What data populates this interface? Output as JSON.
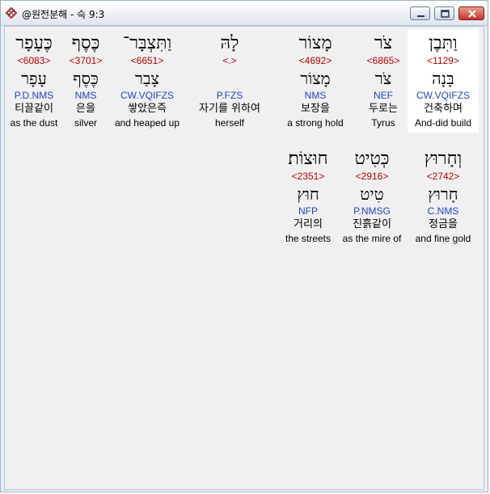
{
  "window": {
    "title": "@원전분해 - 슥 9:3"
  },
  "icons": {
    "app": "app-icon",
    "minimize": "minimize-icon",
    "maximize": "maximize-icon",
    "close": "close-icon"
  },
  "colors": {
    "strong": "#c00000",
    "morph": "#2244cc",
    "selected_bg": "#ffffff"
  },
  "row1": [
    {
      "heb": "וַתִּבֶן",
      "strong": "<1129>",
      "lemma": "בָּנָה",
      "morph": "CW.VQIFZS",
      "korean": "건축하며",
      "english": "And-did build",
      "selected": true
    },
    {
      "heb": "צֹר",
      "strong": "<6865>",
      "lemma": "צֹר",
      "morph": "NEF",
      "korean": "두로는",
      "english": "Tyrus"
    },
    {
      "heb": "מָצוֹר",
      "strong": "<4692>",
      "lemma": "מָצוֹר",
      "morph": "NMS",
      "korean": "보장을",
      "english": "a strong hold"
    },
    {
      "heb": "לָהּ",
      "strong": "<.>",
      "lemma": "",
      "morph": "P.FZS",
      "korean": "자기를 위하여",
      "english": "herself"
    },
    {
      "heb": "וַתִּצְבָּר־",
      "strong": "<6651>",
      "lemma": "צָבַר",
      "morph": "CW.VQIFZS",
      "korean": "쌓았은즉",
      "english": "and heaped up"
    },
    {
      "heb": "כֶּסֶף",
      "strong": "<3701>",
      "lemma": "כֶּסֶף",
      "morph": "NMS",
      "korean": "은을",
      "english": "silver"
    },
    {
      "heb": "כֶּעָפָר",
      "strong": "<6083>",
      "lemma": "עָפָר",
      "morph": "P.D.NMS",
      "korean": "티끌같이",
      "english": "as the dust"
    }
  ],
  "row2": [
    {
      "heb": "וְחָרוּץ",
      "strong": "<2742>",
      "lemma": "חָרוּץ",
      "morph": "C.NMS",
      "korean": "정금을",
      "english": "and fine gold"
    },
    {
      "heb": "כְּטִיט",
      "strong": "<2916>",
      "lemma": "טִיט",
      "morph": "P.NMSG",
      "korean": "진흙같이",
      "english": "as the mire of"
    },
    {
      "heb": "חוּצוֹת׃",
      "strong": "<2351>",
      "lemma": "חוּץ",
      "morph": "NFP",
      "korean": "거리의",
      "english": "the streets"
    }
  ]
}
